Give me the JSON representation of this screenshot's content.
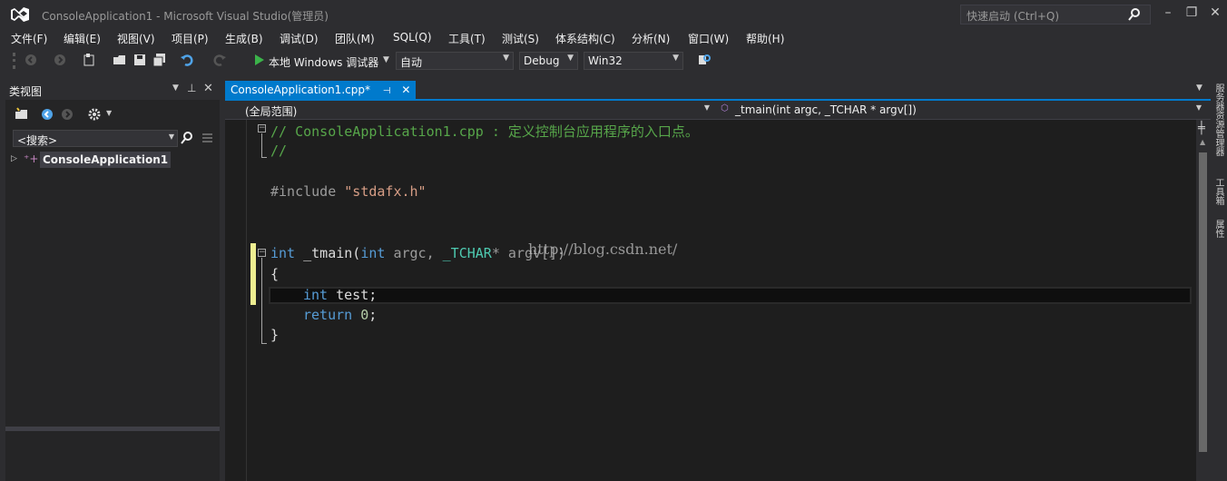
{
  "window": {
    "title": "ConsoleApplication1 - Microsoft Visual Studio(管理员)",
    "quick_launch_placeholder": "快速启动 (Ctrl+Q)"
  },
  "menu": [
    "文件(F)",
    "编辑(E)",
    "视图(V)",
    "项目(P)",
    "生成(B)",
    "调试(D)",
    "团队(M)",
    "SQL(Q)",
    "工具(T)",
    "测试(S)",
    "体系结构(C)",
    "分析(N)",
    "窗口(W)",
    "帮助(H)"
  ],
  "toolbar": {
    "debugger_label": "本地 Windows 调试器",
    "auto_value": "自动",
    "config_value": "Debug",
    "platform_value": "Win32"
  },
  "class_view": {
    "title": "类视图",
    "search_placeholder": "<搜索>",
    "tree_root": "ConsoleApplication1"
  },
  "editor": {
    "tab_label": "ConsoleApplication1.cpp*",
    "scope": "(全局范围)",
    "member": "_tmain(int argc, _TCHAR * argv[])",
    "code": {
      "l1": "// ConsoleApplication1.cpp : 定义控制台应用程序的入口点。",
      "l2": "//",
      "l4_kw": "#include ",
      "l4_str": "\"stdafx.h\"",
      "l6_int": "int",
      "l6_fn": " _tmain(",
      "l6_int2": "int",
      "l6_argc": " argc, ",
      "l6_tchar": "_TCHAR",
      "l6_rest": "* argv[])",
      "l7": "{",
      "l8_int": "int",
      "l8_rest": " test;",
      "l9_ret": "return",
      "l9_num": " 0",
      "l9_semi": ";",
      "l10": "}"
    },
    "watermark": "http://blog.csdn.net/"
  },
  "side_tabs": [
    "服务器资源管理器",
    "工具箱",
    "属性"
  ],
  "colors": {
    "accent": "#007acc",
    "background": "#2d2d30",
    "editor": "#1e1e1e"
  }
}
